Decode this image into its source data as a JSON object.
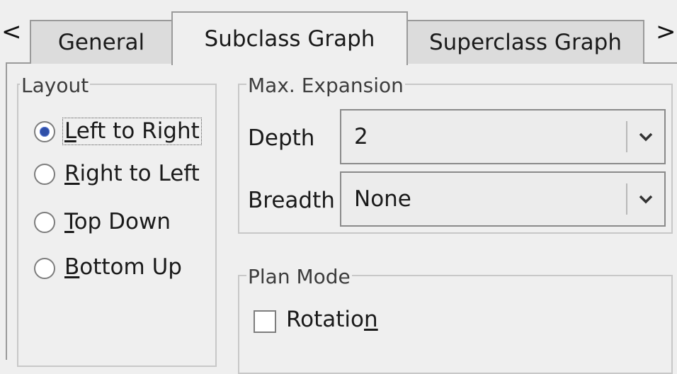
{
  "tabs": {
    "scroll_left": "<",
    "scroll_right": ">",
    "items": [
      {
        "label": "General",
        "selected": false
      },
      {
        "label": "Subclass Graph",
        "selected": true
      },
      {
        "label": "Superclass Graph",
        "selected": false
      }
    ]
  },
  "layout": {
    "legend": "Layout",
    "options": [
      {
        "mnemonic": "L",
        "rest": "eft to Right",
        "checked": true
      },
      {
        "mnemonic": "R",
        "rest": "ight to Left",
        "checked": false
      },
      {
        "mnemonic": "T",
        "rest": "op Down",
        "checked": false
      },
      {
        "mnemonic": "B",
        "rest": "ottom Up",
        "checked": false
      }
    ]
  },
  "expansion": {
    "legend": "Max. Expansion",
    "depth_label": "Depth",
    "depth_value": "2",
    "breadth_label": "Breadth",
    "breadth_value": "None"
  },
  "plan_mode": {
    "legend": "Plan Mode",
    "rotation_prefix": "Rotatio",
    "rotation_mnemonic": "n",
    "rotation_checked": false
  },
  "colors": {
    "background": "#efefef",
    "tab_inactive": "#dcdcdc",
    "radio_selected": "#2f4fa8"
  },
  "icons": {
    "scroll_left": "chevron-left-icon",
    "scroll_right": "chevron-right-icon",
    "dropdown": "chevron-down-icon"
  }
}
